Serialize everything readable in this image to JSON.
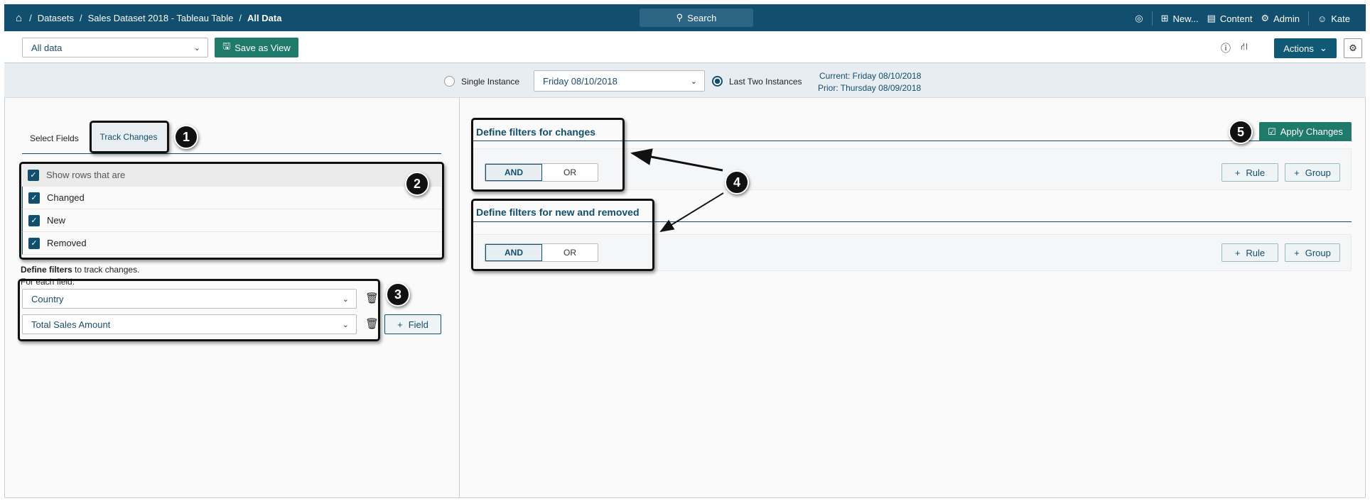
{
  "topbar": {
    "breadcrumbs": [
      "Datasets",
      "Sales Dataset 2018 - Tableau Table",
      "All Data"
    ],
    "search_label": "Search",
    "new_label": "New...",
    "content_label": "Content",
    "admin_label": "Admin",
    "user_label": "Kate"
  },
  "toolbar": {
    "view_select": "All data",
    "save_view": "Save as View",
    "actions": "Actions"
  },
  "instances": {
    "single": "Single Instance",
    "date_select": "Friday 08/10/2018",
    "last_two": "Last Two Instances",
    "current": "Current: Friday 08/10/2018",
    "prior": "Prior: Thursday 08/09/2018",
    "selected": "Last Two Instances"
  },
  "left": {
    "tabs": [
      "Select Fields",
      "Track Changes"
    ],
    "active_tab": "Track Changes",
    "show_rows": "Show rows that are",
    "rows": [
      "Changed",
      "New",
      "Removed"
    ],
    "define_bold": "Define filters",
    "define_rest": " to track changes.",
    "for_each": "For each field:",
    "fields": [
      "Country",
      "Total Sales Amount"
    ],
    "add_field": "Field"
  },
  "right": {
    "apply": "Apply Changes",
    "sections": [
      {
        "title": "Define filters for changes",
        "and": "AND",
        "or": "OR",
        "rule": "Rule",
        "group": "Group"
      },
      {
        "title": "Define filters for new and removed",
        "and": "AND",
        "or": "OR",
        "rule": "Rule",
        "group": "Group"
      }
    ]
  },
  "callouts": [
    "1",
    "2",
    "3",
    "4",
    "5"
  ]
}
